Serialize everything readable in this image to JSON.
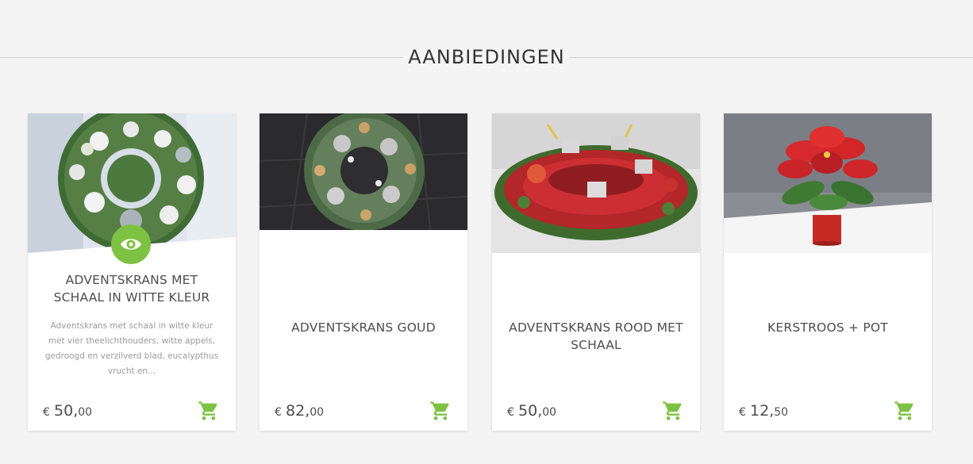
{
  "section": {
    "title": "AANBIEDINGEN"
  },
  "colors": {
    "accent": "#7dc242",
    "background": "#f4f4f4",
    "card": "#ffffff"
  },
  "products": [
    {
      "name": "ADVENTSKRANS MET SCHAAL IN WITTE KLEUR",
      "description": "Adventskrans met schaal in witte kleur met vier theelichthouders, witte appels, gedroogd en verzilverd blad, eucalypthus vrucht en...",
      "currency": "€",
      "price_int": "50,",
      "price_dec": "00",
      "quick_view_icon": "eye-icon",
      "cart_icon": "shopping-cart-icon"
    },
    {
      "name": "ADVENTSKRANS GOUD",
      "currency": "€",
      "price_int": "82,",
      "price_dec": "00",
      "cart_icon": "shopping-cart-icon"
    },
    {
      "name": "ADVENTSKRANS ROOD MET SCHAAL",
      "currency": "€",
      "price_int": "50,",
      "price_dec": "00",
      "cart_icon": "shopping-cart-icon"
    },
    {
      "name": "KERSTROOS + POT",
      "currency": "€",
      "price_int": "12,",
      "price_dec": "50",
      "cart_icon": "shopping-cart-icon"
    }
  ]
}
